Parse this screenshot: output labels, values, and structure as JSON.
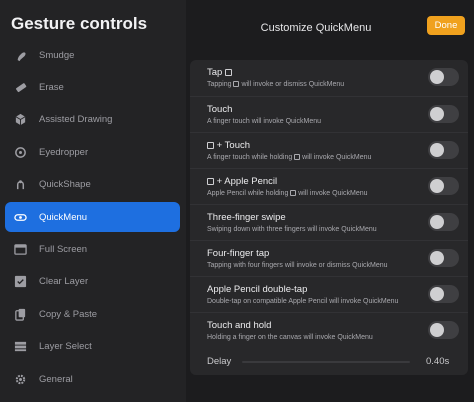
{
  "sidebar": {
    "title": "Gesture controls",
    "items": [
      {
        "label": "Smudge",
        "icon": "smudge-icon"
      },
      {
        "label": "Erase",
        "icon": "erase-icon"
      },
      {
        "label": "Assisted Drawing",
        "icon": "cube-icon"
      },
      {
        "label": "Eyedropper",
        "icon": "eyedropper-icon"
      },
      {
        "label": "QuickShape",
        "icon": "quickshape-icon"
      },
      {
        "label": "QuickMenu",
        "icon": "quickmenu-icon",
        "active": true
      },
      {
        "label": "Full Screen",
        "icon": "fullscreen-icon"
      },
      {
        "label": "Clear Layer",
        "icon": "clear-layer-icon"
      },
      {
        "label": "Copy & Paste",
        "icon": "copy-paste-icon"
      },
      {
        "label": "Layer Select",
        "icon": "layer-select-icon"
      },
      {
        "label": "General",
        "icon": "gear-icon"
      }
    ]
  },
  "header": {
    "title": "Customize QuickMenu",
    "done_label": "Done"
  },
  "colors": {
    "accent": "#1e6fe0",
    "done": "#f0a11e"
  },
  "settings": {
    "rows": [
      {
        "title_pre": "Tap",
        "title_post": "",
        "title_glyph": true,
        "desc_pre": "Tapping",
        "desc_post": "will invoke or dismiss QuickMenu",
        "desc_glyph": true,
        "enabled": false
      },
      {
        "title_pre": "Touch",
        "title_post": "",
        "title_glyph": false,
        "desc_pre": "A finger touch will invoke QuickMenu",
        "desc_post": "",
        "desc_glyph": false,
        "enabled": false
      },
      {
        "title_pre": "",
        "title_post": "+ Touch",
        "title_glyph": true,
        "desc_pre": "A finger touch while holding",
        "desc_post": "will invoke QuickMenu",
        "desc_glyph": true,
        "enabled": false
      },
      {
        "title_pre": "",
        "title_post": "+ Apple Pencil",
        "title_glyph": true,
        "desc_pre": "Apple Pencil while holding",
        "desc_post": "will invoke QuickMenu",
        "desc_glyph": true,
        "enabled": false
      },
      {
        "title_pre": "Three-finger swipe",
        "title_post": "",
        "title_glyph": false,
        "desc_pre": "Swiping down with three fingers will invoke QuickMenu",
        "desc_post": "",
        "desc_glyph": false,
        "enabled": false
      },
      {
        "title_pre": "Four-finger tap",
        "title_post": "",
        "title_glyph": false,
        "desc_pre": "Tapping with four fingers will invoke or dismiss QuickMenu",
        "desc_post": "",
        "desc_glyph": false,
        "enabled": false
      },
      {
        "title_pre": "Apple Pencil double-tap",
        "title_post": "",
        "title_glyph": false,
        "desc_pre": "Double-tap on compatible Apple Pencil will invoke QuickMenu",
        "desc_post": "",
        "desc_glyph": false,
        "enabled": false
      },
      {
        "title_pre": "Touch and hold",
        "title_post": "",
        "title_glyph": false,
        "desc_pre": "Holding a finger on the canvas will invoke QuickMenu",
        "desc_post": "",
        "desc_glyph": false,
        "enabled": false
      }
    ],
    "delay": {
      "label": "Delay",
      "value": "0.40s"
    }
  }
}
